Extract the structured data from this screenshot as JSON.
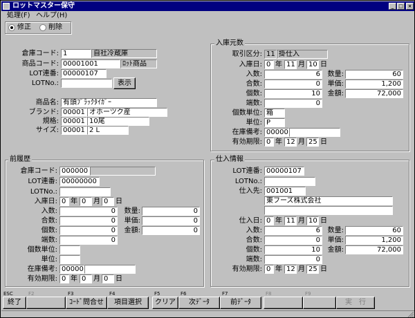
{
  "window": {
    "title": "ロットマスター保守",
    "controls": {
      "minimize": "_",
      "maximize": "□",
      "close": "×"
    }
  },
  "menu": {
    "process": "処理(F)",
    "help": "ヘルプ(H)"
  },
  "mode": {
    "modify": "修正",
    "delete": "削除",
    "selected": "modify"
  },
  "main": {
    "warehouse_code_label": "倉庫コード:",
    "warehouse_code": "1",
    "warehouse_name": "自社冷蔵庫",
    "product_code_label": "商品コード:",
    "product_code": "00001001",
    "product_type": "ﾛｯﾄ商品",
    "lot_serial_label": "LOT連番:",
    "lot_serial": "00000107",
    "lotno_label": "LOTNo.:",
    "lotno": "",
    "display_button": "表示",
    "product_name_label": "商品名:",
    "product_name": "有頭ﾌﾞﾗｯｸﾀｲｶﾞｰ",
    "brand_label": "ブランド:",
    "brand_code": "00001",
    "brand_name": "オホーツク産",
    "spec_label": "規格:",
    "spec_code": "00001",
    "spec_name": "10尾",
    "size_label": "サイズ:",
    "size_code": "00001",
    "size_name": "2 L"
  },
  "receipt": {
    "title": "入庫元数",
    "trans_type_label": "取引区分:",
    "trans_type_code": "11",
    "trans_type_name": "掛仕入",
    "date_label": "入庫日:",
    "year": "0",
    "month": "11",
    "day": "10",
    "qty_in_label": "入数:",
    "qty_in": "6",
    "cases_label": "合数:",
    "cases": "0",
    "pieces_label": "個数:",
    "pieces": "10",
    "odd_label": "端数:",
    "odd": "0",
    "quantity_label": "数量:",
    "quantity": "60",
    "unit_price_label": "単価:",
    "unit_price": "1,200",
    "amount_label": "金額:",
    "amount": "72,000",
    "piece_unit_label": "個数単位:",
    "piece_unit": "箱",
    "unit_label": "単位:",
    "unit": "P",
    "stock_note_label": "在庫備考:",
    "stock_note_code": "00000",
    "stock_note": "",
    "expiry_label": "有効期限:",
    "exp_year": "0",
    "exp_month": "12",
    "exp_day": "25"
  },
  "history": {
    "title": "前履歴",
    "warehouse_code_label": "倉庫コード:",
    "warehouse_code": "000000",
    "warehouse_name": "",
    "lot_serial_label": "LOT連番:",
    "lot_serial": "00000000",
    "lotno_label": "LOTNo.:",
    "lotno": "",
    "date_label": "入庫日:",
    "year": "0",
    "month": "0",
    "day": "0",
    "qty_in_label": "入数:",
    "qty_in": "0",
    "cases_label": "合数:",
    "cases": "0",
    "pieces_label": "個数:",
    "pieces": "0",
    "odd_label": "端数:",
    "odd": "0",
    "quantity_label": "数量:",
    "quantity": "0",
    "unit_price_label": "単価:",
    "unit_price": "0",
    "amount_label": "金額:",
    "amount": "0",
    "piece_unit_label": "個数単位:",
    "piece_unit": "",
    "unit_label": "単位:",
    "unit": "",
    "stock_note_label": "在庫備考:",
    "stock_note_code": "00000",
    "stock_note": "",
    "expiry_label": "有効期限:",
    "exp_year": "0",
    "exp_month": "0",
    "exp_day": "0"
  },
  "purchase": {
    "title": "仕入情報",
    "lot_serial_label": "LOT連番:",
    "lot_serial": "00000107",
    "lotno_label": "LOTNo.:",
    "lotno": "",
    "supplier_label": "仕入先:",
    "supplier_code": "001001",
    "supplier_name": "東フーズ株式会社",
    "supplier_name2": "",
    "date_label": "仕入日:",
    "year": "0",
    "month": "11",
    "day": "10",
    "qty_in_label": "入数:",
    "qty_in": "6",
    "cases_label": "合数:",
    "cases": "0",
    "pieces_label": "個数:",
    "pieces": "10",
    "odd_label": "端数:",
    "odd": "0",
    "quantity_label": "数量:",
    "quantity": "60",
    "unit_price_label": "単価:",
    "unit_price": "1,200",
    "amount_label": "金額:",
    "amount": "72,000",
    "expiry_label": "有効期限:",
    "exp_year": "0",
    "exp_month": "12",
    "exp_day": "25"
  },
  "date_units": {
    "year": "年",
    "month": "月",
    "day": "日"
  },
  "fkeys": [
    {
      "key": "ESC",
      "label": "終了",
      "enabled": true
    },
    {
      "key": "F2",
      "label": "",
      "enabled": false
    },
    {
      "key": "F3",
      "label": "ｺｰﾄﾞ問合せ",
      "enabled": true
    },
    {
      "key": "F4",
      "label": "項目選択",
      "enabled": true
    },
    {
      "key": "F5",
      "label": "クリア",
      "enabled": true
    },
    {
      "key": "F6",
      "label": "次ﾃﾞｰﾀ",
      "enabled": true
    },
    {
      "key": "F7",
      "label": "前ﾃﾞｰﾀ",
      "enabled": true
    },
    {
      "key": "F8",
      "label": "",
      "enabled": false
    },
    {
      "key": "F9",
      "label": "",
      "enabled": false
    },
    {
      "key": "",
      "label": "実　行",
      "enabled": false
    }
  ]
}
